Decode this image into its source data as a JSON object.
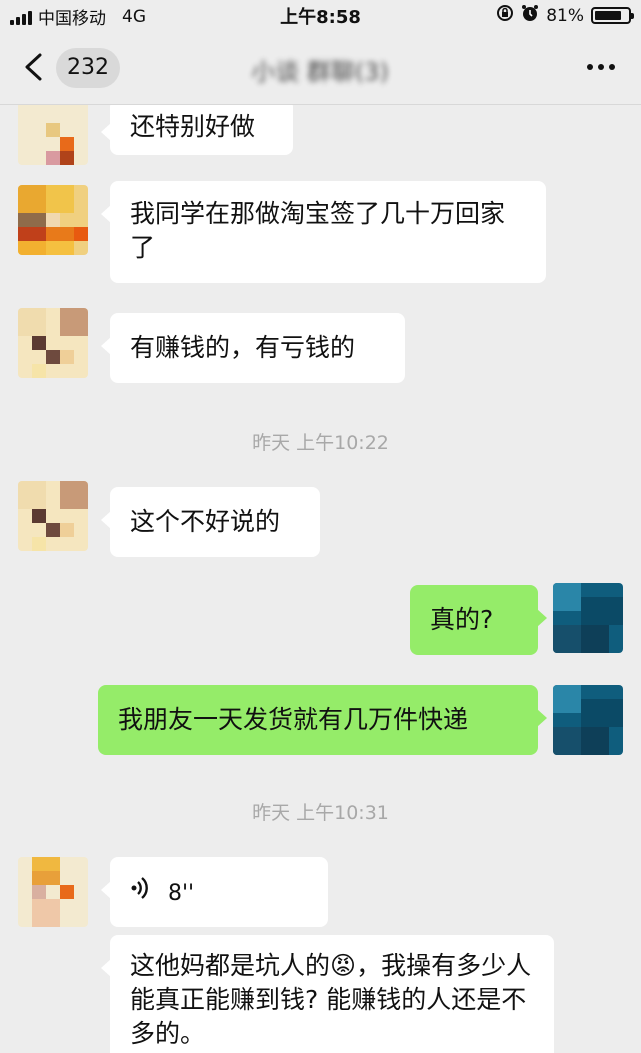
{
  "status_bar": {
    "carrier": "中国移动",
    "network": "4G",
    "time": "上午8:58",
    "battery": "81%",
    "battery_level": 0.81
  },
  "nav": {
    "back_count": "232",
    "title": "小谈  群聊(3)"
  },
  "messages": [
    {
      "type": "text",
      "side": "in",
      "text": "还特别好做"
    },
    {
      "type": "text",
      "side": "in",
      "text": "我同学在那做淘宝签了几十万回家了"
    },
    {
      "type": "text",
      "side": "in",
      "text": "有赚钱的，有亏钱的"
    },
    {
      "type": "timestamp",
      "text": "昨天 上午10:22"
    },
    {
      "type": "text",
      "side": "in",
      "text": "这个不好说的"
    },
    {
      "type": "text",
      "side": "out",
      "text": "真的?"
    },
    {
      "type": "text",
      "side": "out",
      "text": "我朋友一天发货就有几万件快递"
    },
    {
      "type": "timestamp",
      "text": "昨天 上午10:31"
    },
    {
      "type": "voice",
      "side": "in",
      "duration": "8''"
    },
    {
      "type": "text",
      "side": "in",
      "text": "这他妈都是坑人的😡，我操有多少人能真正能赚到钱? 能赚钱的人还是不多的。"
    }
  ],
  "icons": {
    "signal": "signal-icon",
    "orientation_lock": "orientation-lock-icon",
    "alarm": "alarm-icon",
    "battery": "battery-icon",
    "back": "chevron-left-icon",
    "more": "more-icon",
    "voice": "voice-wave-icon"
  }
}
